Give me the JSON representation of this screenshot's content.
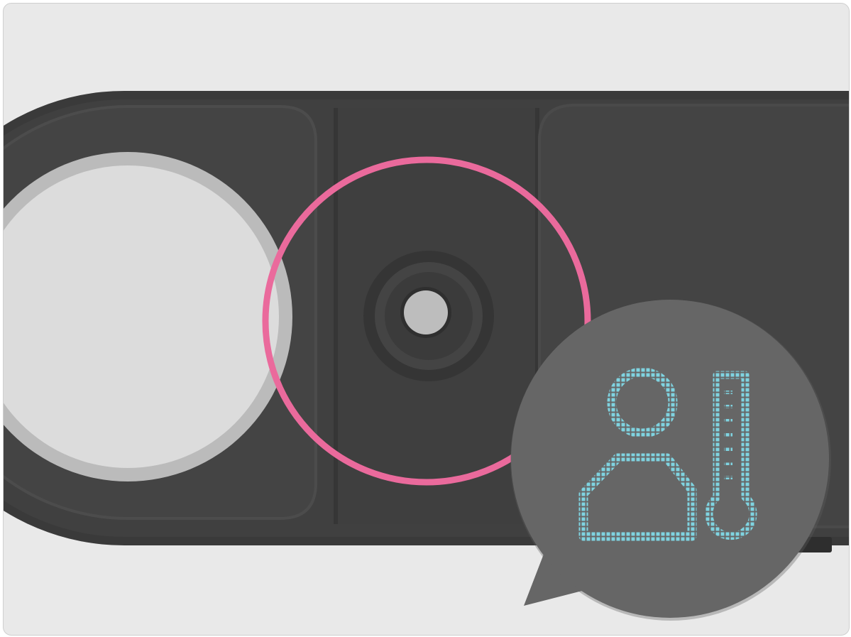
{
  "illustration": {
    "subject": "device-sensor-highlight",
    "icon": "person-temperature-icon",
    "colors": {
      "background": "#e9e9e9",
      "device_body": "#3a3a3a",
      "device_panel": "#444444",
      "button_face": "#dcdcdc",
      "button_ring": "#bbbbbb",
      "sensor": "#bdbdbd",
      "highlight_ring": "#ea6a9c",
      "bubble": "#666666",
      "icon_dots": "#7fd3e0"
    }
  }
}
